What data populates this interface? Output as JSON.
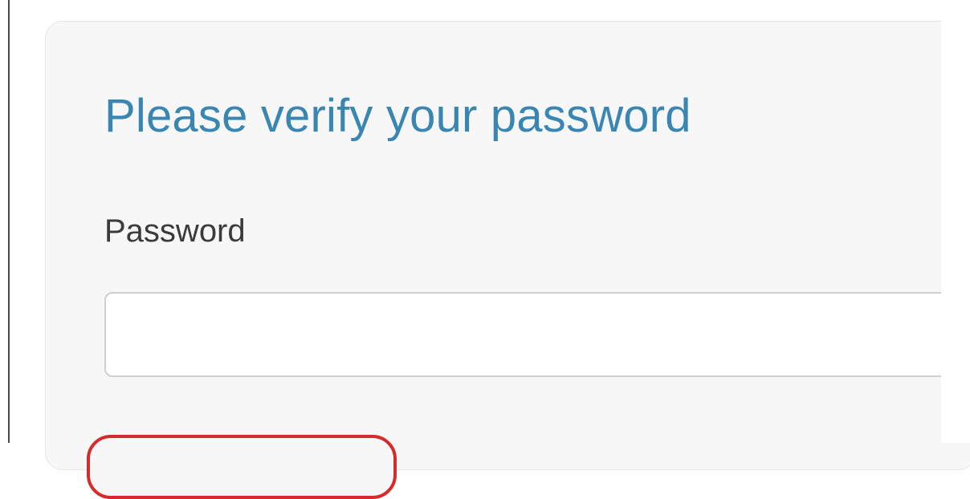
{
  "form": {
    "title": "Please verify your password",
    "password_label": "Password",
    "password_value": "",
    "password_placeholder": ""
  },
  "colors": {
    "title": "#3a86b3",
    "label": "#3b3b3b",
    "card_background": "#f7f7f7",
    "input_border": "#cfcfcf",
    "highlight": "#d62b2b"
  }
}
